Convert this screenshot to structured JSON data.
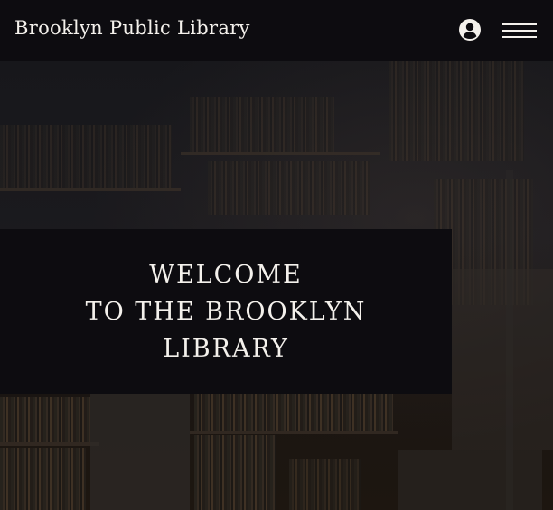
{
  "header": {
    "site_title": "Brooklyn Public Library",
    "account_icon": "user-circle-icon",
    "menu_icon": "hamburger-menu-icon"
  },
  "hero": {
    "welcome_lines": [
      "WELCOME",
      "TO THE BROOKLYN",
      "LIBRARY"
    ]
  },
  "colors": {
    "background": "#0d0c10",
    "text": "#f4f1ec"
  }
}
